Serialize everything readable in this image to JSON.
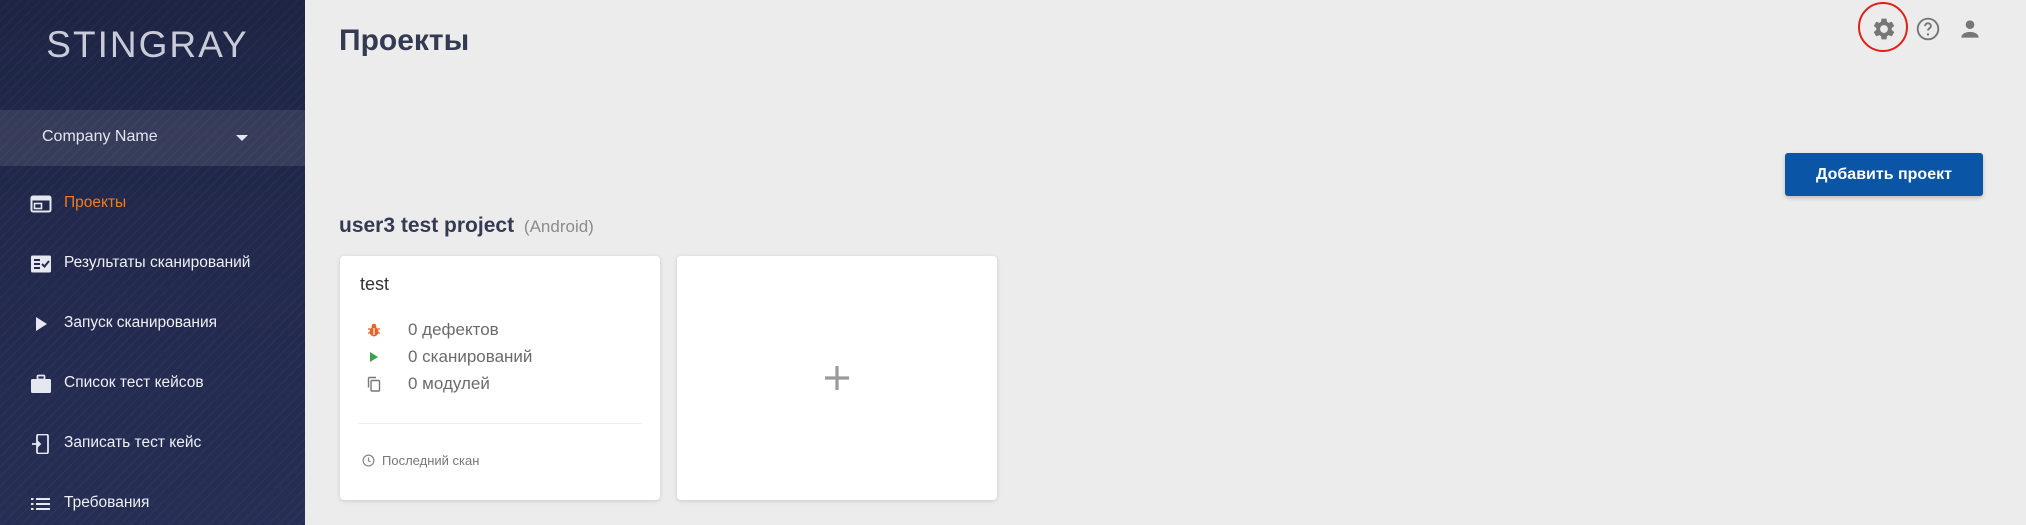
{
  "sidebar": {
    "logo": "STINGRAY",
    "company": "Company Name",
    "items": [
      {
        "label": "Проекты",
        "icon": "projects-icon",
        "active": true
      },
      {
        "label": "Результаты сканирований",
        "icon": "scan-results-icon"
      },
      {
        "label": "Запуск сканирования",
        "icon": "play-icon"
      },
      {
        "label": "Список тест кейсов",
        "icon": "briefcase-icon"
      },
      {
        "label": "Записать тест кейс",
        "icon": "record-device-icon"
      },
      {
        "label": "Требования",
        "icon": "list-icon"
      }
    ]
  },
  "header": {
    "title": "Проекты",
    "icons": [
      "gear-icon",
      "help-icon",
      "user-icon"
    ]
  },
  "toolbar": {
    "add_project_label": "Добавить проект"
  },
  "project": {
    "name": "user3 test project",
    "platform": "(Android)",
    "card": {
      "title": "test",
      "defects": "0 дефектов",
      "scans": "0 сканирований",
      "modules": "0 модулей",
      "last_scan": "Последний скан"
    }
  },
  "colors": {
    "accent": "#f07b23",
    "primary_button": "#0a55a6",
    "highlight": "#e0201b",
    "sidebar_bg": "#1d2444",
    "play_green": "#3aa24a"
  }
}
